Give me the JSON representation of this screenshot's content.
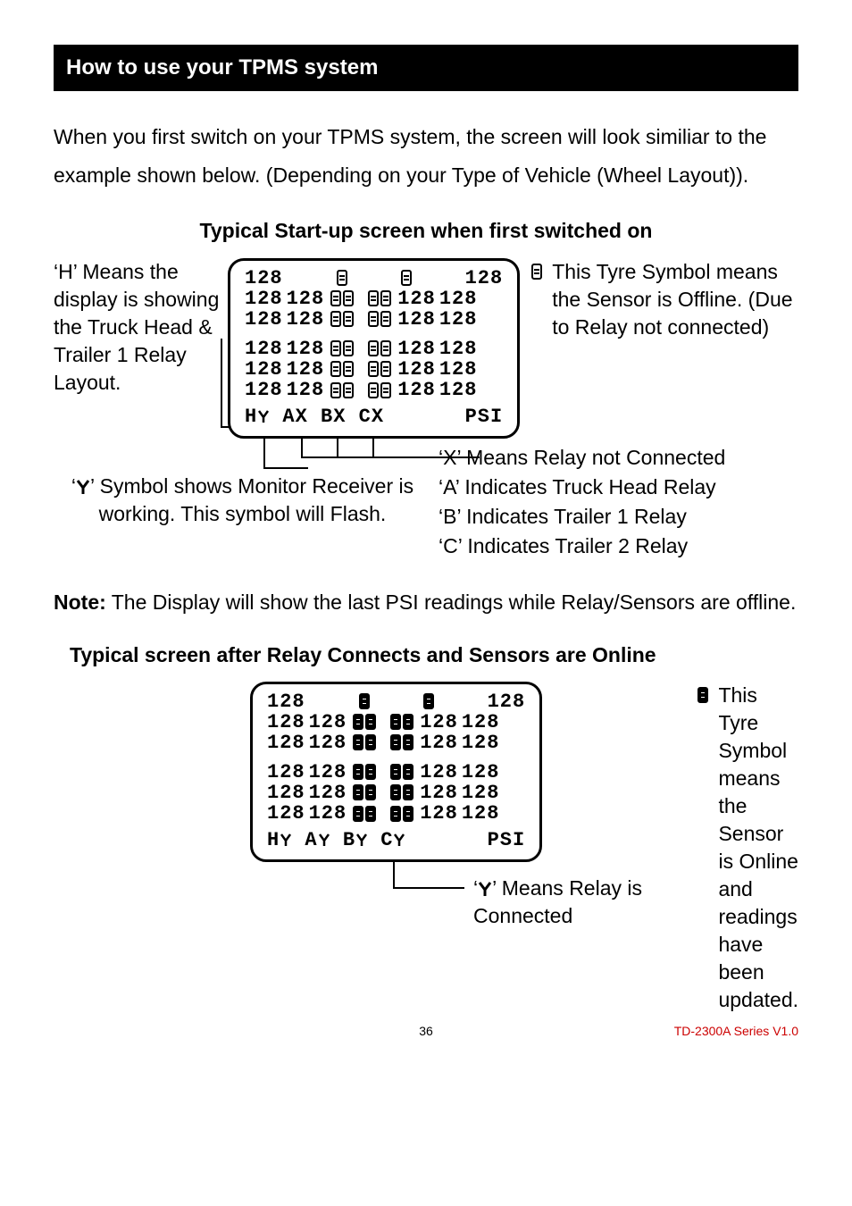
{
  "section_title": "How to use your TPMS system",
  "intro": "When you first switch on your TPMS system, the screen will look similiar to the example shown below. (Depending on your Type of Vehicle (Wheel Layout)).",
  "heading1": "Typical Start-up screen when first switched on",
  "left_note": "‘H’ Means the display is showing the Truck Head & Trailer 1 Relay Layout.",
  "psi_value": "128",
  "status_line_1_left": "H",
  "status_line_1_relays": "AX BX CX",
  "status_unit": "PSI",
  "right_note_1": "This Tyre Symbol means the Sensor is Offline. (Due to Relay not connected)",
  "callout_x": "‘X’ Means Relay not Connected",
  "callout_a": "‘A’ Indicates Truck Head Relay",
  "callout_b": "‘B’ Indicates Trailer 1 Relay",
  "callout_c": "‘C’ Indicates Trailer 2 Relay",
  "monitor_note_prefix": "‘",
  "monitor_note_suffix": "’ Symbol shows Monitor Receiver is working. This symbol will Flash.",
  "note_label": "Note:",
  "note_text": " The Display will show the last PSI readings while Relay/Sensors are offline.",
  "heading2": "Typical screen after Relay Connects and Sensors are Online",
  "status_line_2_left": "H",
  "status_line_2_relays_a": "A",
  "status_line_2_relays_b": "B",
  "status_line_2_relays_c": "C",
  "right_note_2": "This Tyre Symbol means the Sensor is Online and readings have been updated.",
  "relay_connected_prefix": "‘",
  "relay_connected_suffix": "’ Means Relay is Connected",
  "page_number": "36",
  "doc_id": "TD-2300A Series V1.0"
}
